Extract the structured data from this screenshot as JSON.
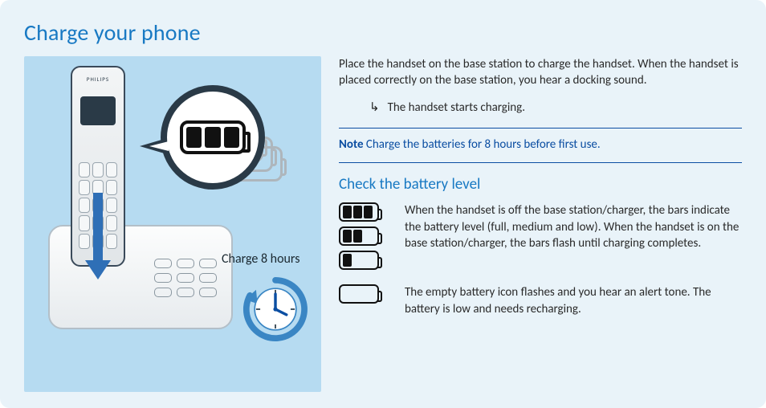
{
  "title": "Charge your phone",
  "intro": "Place the handset on the base station to charge the handset. When the handset is placed correctly on the base station, you hear a docking sound.",
  "bullet": "The handset starts charging.",
  "note_label": "Note",
  "note_text": "Charge the batteries for 8 hours before first use.",
  "subheading": "Check the battery level",
  "rows": [
    {
      "text": "When the handset is off the base station/charger, the bars indicate the battery level (full, medium and low). When the handset is on the base station/charger, the bars flash until charging completes."
    },
    {
      "text": "The empty battery icon flashes and you hear an alert tone. The battery is low and needs recharging."
    }
  ],
  "illustration": {
    "charge_label": "Charge 8 hours",
    "phone_brand": "PHILIPS",
    "clock_hours": 8
  },
  "icons": {
    "return_arrow": "↳"
  },
  "colors": {
    "accent": "#1879c3",
    "note": "#0b4ea2",
    "panel_bg": "#e9f3f9",
    "left_bg": "#b6dbf1"
  }
}
